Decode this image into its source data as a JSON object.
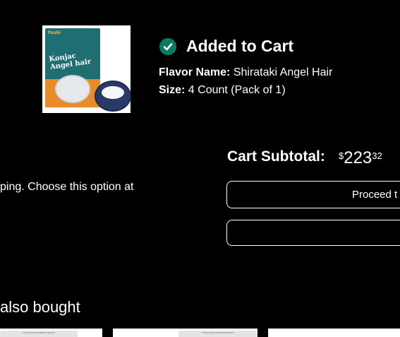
{
  "confirmation": {
    "title": "Added to Cart",
    "flavor_label": "Flavor Name:",
    "flavor_value": "Shirataki Angel Hair",
    "size_label": "Size:",
    "size_value": "4 Count (Pack of 1)",
    "check_icon": "check-circle-icon",
    "check_color": "#067d62"
  },
  "product": {
    "brand_text": "Fushi",
    "package_name": "Konjac Angel hair"
  },
  "subtotal": {
    "label": "Cart Subtotal:",
    "currency": "$",
    "whole": "223",
    "fraction": "32"
  },
  "shipping_note": "ping. Choose this option at",
  "buttons": {
    "proceed_label": "Proceed t",
    "go_to_cart_label": ""
  },
  "recommendations": {
    "heading": "also bought",
    "banner_text": "FOODS FOR OPTIMUM HEALTH"
  }
}
